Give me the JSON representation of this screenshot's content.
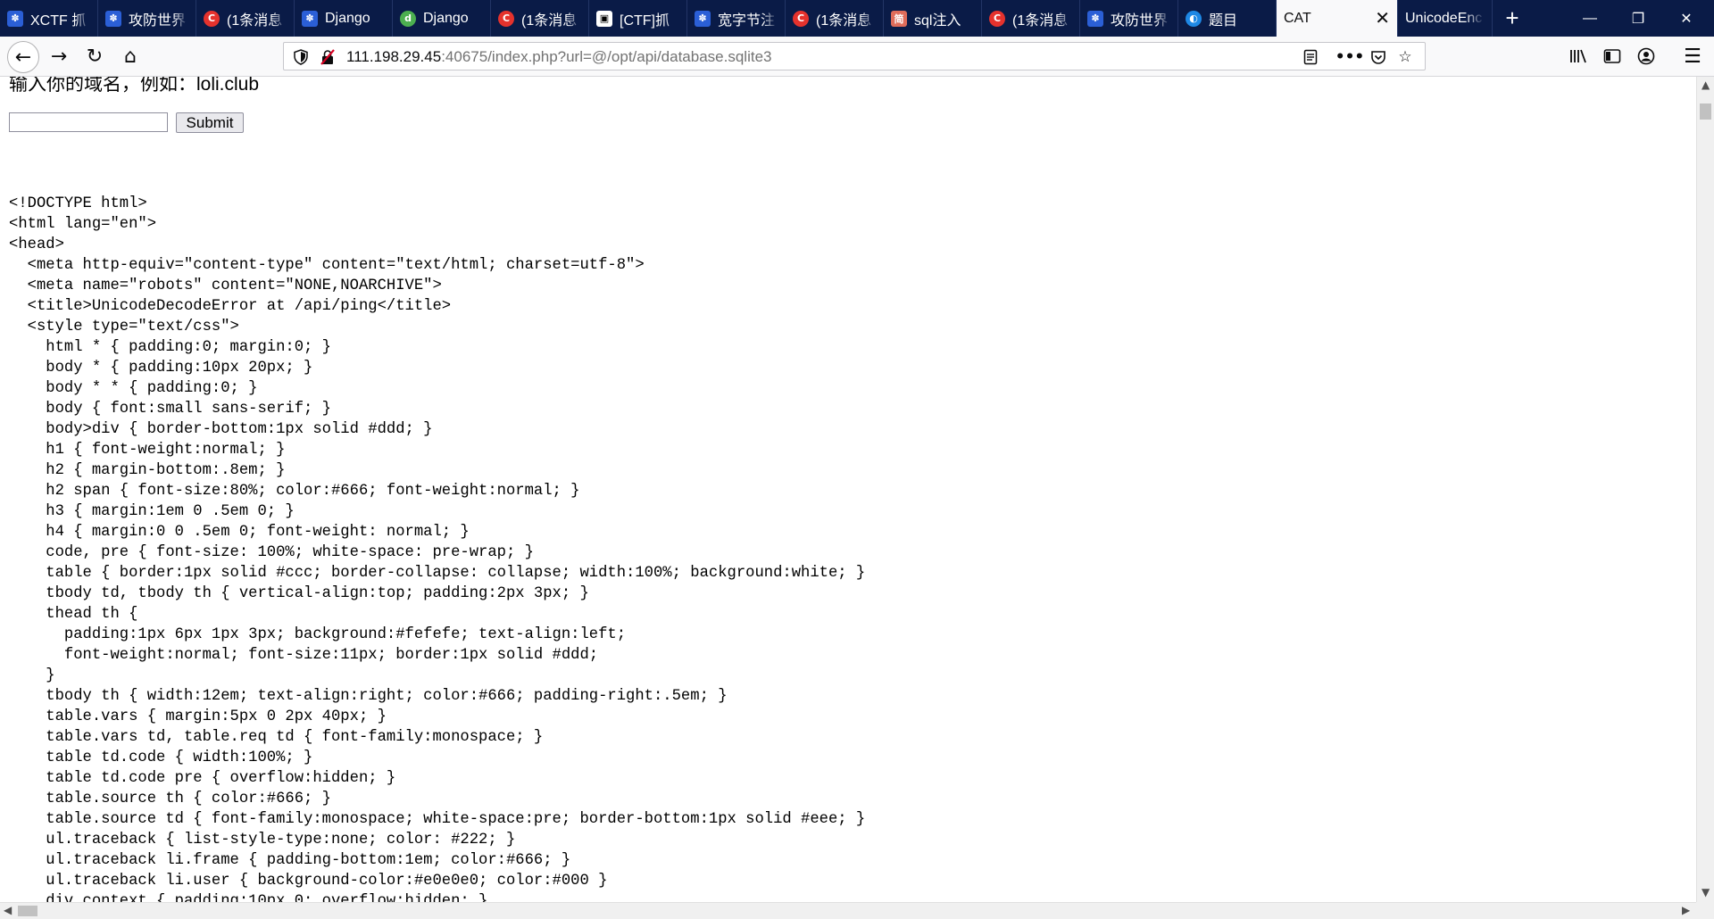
{
  "tabs": [
    {
      "label": "XCTF 抓",
      "icon": "paw-icon",
      "favclass": "fav-paw",
      "glyph": "✽"
    },
    {
      "label": "攻防世界",
      "icon": "paw-icon",
      "favclass": "fav-paw",
      "glyph": "✽"
    },
    {
      "label": "(1条消息",
      "icon": "csdn-c-icon",
      "favclass": "fav-c",
      "glyph": "C"
    },
    {
      "label": "Django",
      "icon": "paw-icon",
      "favclass": "fav-paw",
      "glyph": "✽"
    },
    {
      "label": "Django",
      "icon": "django-icon",
      "favclass": "fav-dj",
      "glyph": "d"
    },
    {
      "label": "(1条消息",
      "icon": "csdn-c-icon",
      "favclass": "fav-c",
      "glyph": "C"
    },
    {
      "label": "[CTF]抓",
      "icon": "ctf-icon",
      "favclass": "fav-ctf",
      "glyph": "▣"
    },
    {
      "label": "宽字节注",
      "icon": "paw-icon",
      "favclass": "fav-paw",
      "glyph": "✽"
    },
    {
      "label": "(1条消息",
      "icon": "csdn-c-icon",
      "favclass": "fav-c",
      "glyph": "C"
    },
    {
      "label": "sql注入",
      "icon": "jianshu-icon",
      "favclass": "fav-jian",
      "glyph": "简"
    },
    {
      "label": "(1条消息",
      "icon": "csdn-c-icon",
      "favclass": "fav-c",
      "glyph": "C"
    },
    {
      "label": "攻防世界",
      "icon": "paw-icon",
      "favclass": "fav-paw",
      "glyph": "✽"
    },
    {
      "label": "题目",
      "icon": "globe-icon",
      "favclass": "fav-globe",
      "glyph": "◐"
    }
  ],
  "active_tab": {
    "label": "CAT",
    "close": "✕"
  },
  "after_tab": {
    "label": "UnicodeEnc"
  },
  "window": {
    "minimize": "—",
    "restore": "❐",
    "close": "✕",
    "new_tab": "+"
  },
  "nav": {
    "back": "←",
    "forward": "→",
    "reload": "↻",
    "home": "⌂",
    "url_host": "111.198.29.45",
    "url_rest": ":40675/index.php?url=@/opt/api/database.sqlite3",
    "menu": "☰"
  },
  "page": {
    "prompt": "输入你的域名，例如：loli.club",
    "input_value": "",
    "submit_label": "Submit",
    "source_lines": [
      "<!DOCTYPE html>",
      "<html lang=\"en\">",
      "<head>",
      "  <meta http-equiv=\"content-type\" content=\"text/html; charset=utf-8\">",
      "  <meta name=\"robots\" content=\"NONE,NOARCHIVE\">",
      "  <title>UnicodeDecodeError at /api/ping</title>",
      "  <style type=\"text/css\">",
      "    html * { padding:0; margin:0; }",
      "    body * { padding:10px 20px; }",
      "    body * * { padding:0; }",
      "    body { font:small sans-serif; }",
      "    body>div { border-bottom:1px solid #ddd; }",
      "    h1 { font-weight:normal; }",
      "    h2 { margin-bottom:.8em; }",
      "    h2 span { font-size:80%; color:#666; font-weight:normal; }",
      "    h3 { margin:1em 0 .5em 0; }",
      "    h4 { margin:0 0 .5em 0; font-weight: normal; }",
      "    code, pre { font-size: 100%; white-space: pre-wrap; }",
      "    table { border:1px solid #ccc; border-collapse: collapse; width:100%; background:white; }",
      "    tbody td, tbody th { vertical-align:top; padding:2px 3px; }",
      "    thead th {",
      "      padding:1px 6px 1px 3px; background:#fefefe; text-align:left;",
      "      font-weight:normal; font-size:11px; border:1px solid #ddd;",
      "    }",
      "    tbody th { width:12em; text-align:right; color:#666; padding-right:.5em; }",
      "    table.vars { margin:5px 0 2px 40px; }",
      "    table.vars td, table.req td { font-family:monospace; }",
      "    table td.code { width:100%; }",
      "    table td.code pre { overflow:hidden; }",
      "    table.source th { color:#666; }",
      "    table.source td { font-family:monospace; white-space:pre; border-bottom:1px solid #eee; }",
      "    ul.traceback { list-style-type:none; color: #222; }",
      "    ul.traceback li.frame { padding-bottom:1em; color:#666; }",
      "    ul.traceback li.user { background-color:#e0e0e0; color:#000 }",
      "    div.context { padding:10px 0; overflow:hidden; }"
    ]
  },
  "colors": {
    "tabbar": "#0a1b47",
    "navbar": "#f9f9fa",
    "page": "#ffffff"
  }
}
